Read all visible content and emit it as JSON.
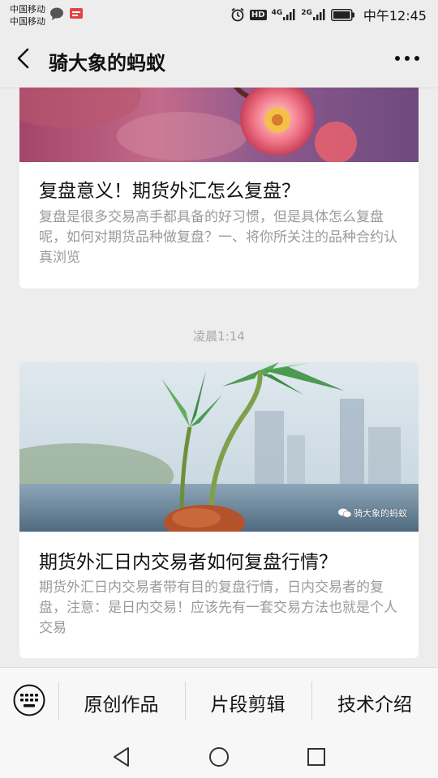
{
  "status_bar": {
    "carrier_1": "中国移动",
    "carrier_2": "中国移动",
    "notification_icons": [
      "chat-bubble-icon",
      "app-badge-icon"
    ],
    "hd_badge": "HD",
    "network_1": "4G",
    "network_2": "2G",
    "time": "中午12:45"
  },
  "header": {
    "title": "骑大象的蚂蚁",
    "back_icon": "back-arrow-icon",
    "more_icon": "more-icon"
  },
  "feed": {
    "articles": [
      {
        "title": "复盘意义！期货外汇怎么复盘？",
        "summary": "复盘是很多交易高手都具备的好习惯，但是具体怎么复盘呢，如何对期货品种做复盘？一、将你所关注的品种合约认真浏览"
      },
      {
        "title": "期货外汇日内交易者如何复盘行情？",
        "summary": "期货外汇日内交易者带有目的复盘行情，日内交易者的复盘，注意：是日内交易！应该先有一套交易方法也就是个人交易",
        "watermark": "骑大象的蚂蚁"
      }
    ],
    "timestamp": "凌晨1:14"
  },
  "menu": {
    "keyboard_icon": "keyboard-icon",
    "items": [
      "原创作品",
      "片段剪辑",
      "技术介绍"
    ]
  },
  "nav": {
    "icons": [
      "nav-back-icon",
      "nav-home-icon",
      "nav-recents-icon"
    ]
  },
  "colors": {
    "background": "#ededed",
    "card": "#ffffff",
    "summary_text": "#9a9a9a",
    "timestamp_text": "#a8a8a8"
  }
}
